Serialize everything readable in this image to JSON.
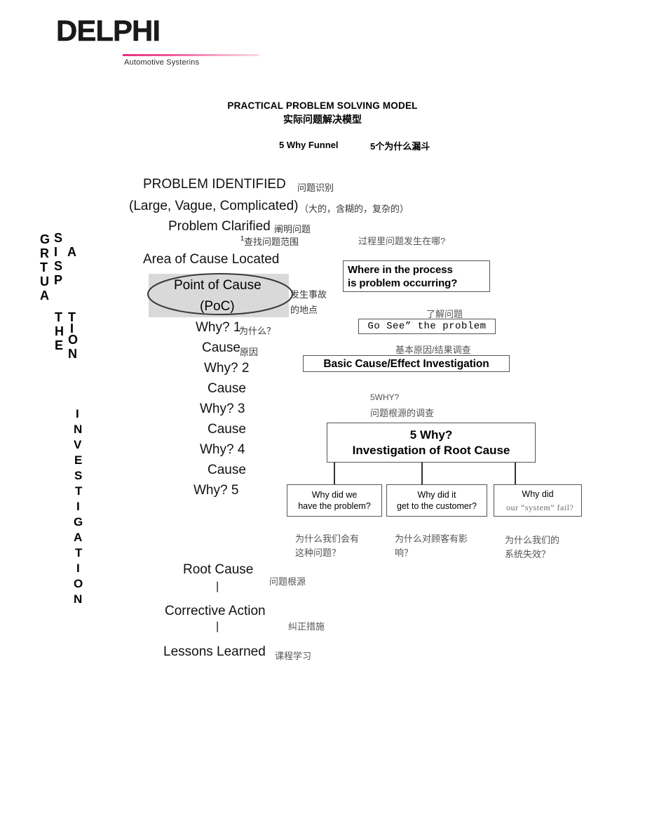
{
  "logo": {
    "word": "DELPHI",
    "tagline": "Automotive Systerins",
    "accent_color": "#e8307f"
  },
  "header": {
    "title_en": "PRACTICAL PROBLEM SOLVING MODEL",
    "title_cn": "实际问题解决模型",
    "subtitle_en": "5 Why Funnel",
    "subtitle_cn": "5个为什么漏斗"
  },
  "side_labels": {
    "grasp_the_situation": {
      "column_1": [
        "G",
        "R",
        "T",
        "U",
        "A"
      ],
      "column_2": [
        "S",
        "I",
        "S",
        "P"
      ],
      "column_3": [
        "A"
      ],
      "column_2_lower": [
        "T",
        "H",
        "E"
      ],
      "column_3_lower": [
        "T",
        "I",
        "O",
        "N"
      ],
      "words": [
        "GRASP",
        "THE",
        "SITUATION"
      ]
    },
    "investigation": [
      "I",
      "N",
      "V",
      "E",
      "S",
      "T",
      "I",
      "G",
      "A",
      "T",
      "I",
      "O",
      "N"
    ]
  },
  "funnel": {
    "steps": [
      {
        "en": "PROBLEM IDENTIFIED",
        "cn": "问题识别"
      },
      {
        "en": "(Large, Vague, Complicated)",
        "cn": "（大的，含糊的，复杂的）"
      },
      {
        "en": "Problem Clarified",
        "cn": "阐明问题"
      },
      {
        "en": "",
        "cn": "查找问题范围",
        "superscript": "1"
      },
      {
        "en": "Area of Cause Located",
        "cn": ""
      },
      {
        "en": "Point of Cause",
        "en2": "(PoC)",
        "cn": "发生事故",
        "cn2": "的地点"
      },
      {
        "en": "Why? 1",
        "cn": "为什么？"
      },
      {
        "en": "Cause",
        "cn": "原因"
      },
      {
        "en": "Why? 2",
        "cn": ""
      },
      {
        "en": "Cause",
        "cn": ""
      },
      {
        "en": "Why? 3",
        "cn": ""
      },
      {
        "en": "Cause",
        "cn": ""
      },
      {
        "en": "Why? 4",
        "cn": ""
      },
      {
        "en": "Cause",
        "cn": ""
      },
      {
        "en": "Why? 5",
        "cn": ""
      }
    ],
    "tail": [
      {
        "en": "Root Cause",
        "cn": "问题根源"
      },
      {
        "en": "Corrective Action",
        "cn": "纠正措施"
      },
      {
        "en": "Lessons Learned",
        "cn": "课程学习"
      }
    ],
    "connector": "|"
  },
  "right_panel": {
    "where_note_cn": "过程里问题发生在哪?",
    "where_box_line1": "Where in the process",
    "where_box_line2": "is problem occurring?",
    "gosee_note_cn": "了解问题",
    "gosee_box": "Go See” the problem",
    "basic_note_cn": "基本原因/结果调查",
    "basic_box": "Basic Cause/Effect Investigation",
    "why5_note_en": "5WHY?",
    "why5_note_cn": "问题根源的调查",
    "why5_box_line1": "5 Why?",
    "why5_box_line2": "Investigation of Root Cause",
    "sub_boxes": [
      {
        "line1": "Why did we",
        "line2": "have the problem?",
        "line2_overflow": "",
        "cn1": "为什么我们会有",
        "cn2": "这种问题？"
      },
      {
        "line1": "Why  did it",
        "line2": "get to the customer?",
        "line2_overflow": "",
        "cn1": "为什么对顾客有影",
        "cn2": "响？"
      },
      {
        "line1": "Why did",
        "line2": "",
        "line2_overflow": "our  “system”  fail?",
        "cn1": "为什么我们的",
        "cn2": "系统失效？"
      }
    ]
  }
}
